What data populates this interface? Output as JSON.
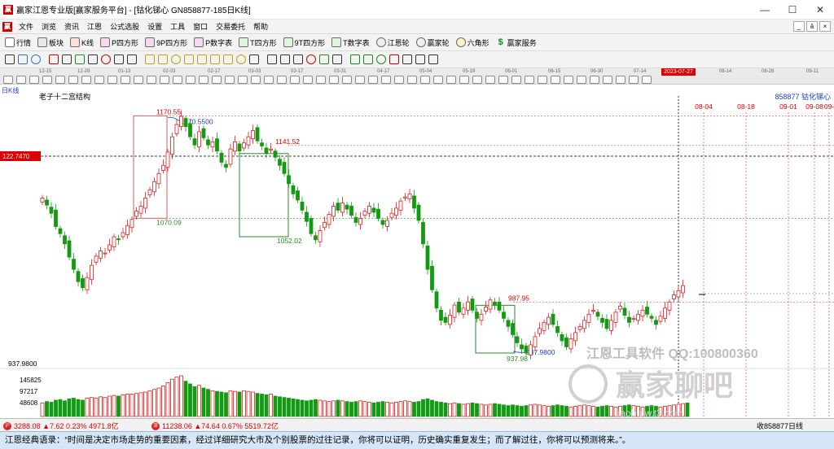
{
  "window": {
    "title": "赢家江恩专业版[赢家服务平台] - [钴化锑心 GN858877-185日K线]",
    "controls": [
      "—",
      "☐",
      "✕"
    ]
  },
  "menu": {
    "items": [
      "文件",
      "浏览",
      "资讯",
      "江恩",
      "公式选股",
      "设置",
      "工具",
      "窗口",
      "交易委托",
      "帮助"
    ],
    "mdi_controls": [
      "_",
      "ā",
      "×"
    ]
  },
  "toolbar": {
    "buttons": [
      "行情",
      "板块",
      "K线",
      "P四方形",
      "9P四方形",
      "P数字表",
      "T四方形",
      "9T四方形",
      "T数字表",
      "江恩轮",
      "赢家轮",
      "六角形",
      "赢家服务"
    ]
  },
  "date_strip": {
    "labels": [
      "12-15",
      "12-29",
      "01-13",
      "02-03",
      "02-17",
      "03-03",
      "03-17",
      "03-31",
      "04-17",
      "05-04",
      "05-19",
      "06-01",
      "06-15",
      "06-30",
      "07-14",
      "07-27",
      "08-14",
      "08-28",
      "09-11"
    ],
    "current": "2023-07-27"
  },
  "header": {
    "period": "日K线",
    "structure_name": "老子十二宫结构",
    "code_name": "858877  钴化锑心",
    "future_dates": [
      "08-04",
      "08-18",
      "09-01",
      "09-08",
      "09-"
    ]
  },
  "annotations": {
    "left_price": "122.7470",
    "low_label_left": "937.9800",
    "price_levels": [
      "1170.55",
      "1141.52",
      "1070.09",
      "1052.02",
      "987.95",
      "937.98",
      "937.9800"
    ],
    "swing_label": "1170.5500",
    "vol_ticks": [
      "145825",
      "97217",
      "48608"
    ]
  },
  "watermark": {
    "line1": "江恩工具软件 QQ:100800360",
    "line2": "赢家聊吧",
    "line3": "liaoba.w.t3.com"
  },
  "status": {
    "index1": {
      "value": "3288.08",
      "change": "▲7.62",
      "pct": "0.23%",
      "amount": "4971.8亿"
    },
    "index2": {
      "value": "11238.06",
      "change": "▲74.64",
      "pct": "0.67%",
      "amount": "5519.72亿"
    },
    "right": "收858877日线"
  },
  "quote": "江恩经典语录：“时间是决定市场走势的重要因素，经过详细研究大市及个别股票的过往记录，你将可以证明，历史确实重复发生；而了解过往，你将可以预测将来。”。",
  "chart_data": {
    "type": "candlestick",
    "y_range": [
      930,
      1190
    ],
    "levels": {
      "hi": 1170.55,
      "box1_hi": 1141.52,
      "box1_lo": 1070.09,
      "box2_lo": 1052.02,
      "box3_hi": 987.95,
      "box3_lo": 937.98
    },
    "closes": [
      1090,
      1083,
      1075,
      1062,
      1055,
      1045,
      1032,
      1020,
      1008,
      1002,
      1012,
      1024,
      1033,
      1038,
      1036,
      1044,
      1052,
      1049,
      1056,
      1063,
      1069,
      1077,
      1082,
      1090,
      1098,
      1106,
      1114,
      1122,
      1135,
      1150,
      1162,
      1170,
      1160,
      1150,
      1142,
      1155,
      1149,
      1142,
      1145,
      1136,
      1125,
      1120,
      1138,
      1145,
      1136,
      1144,
      1150,
      1156,
      1146,
      1141,
      1134,
      1138,
      1130,
      1122,
      1114,
      1104,
      1094,
      1088,
      1078,
      1067,
      1055,
      1049,
      1058,
      1066,
      1074,
      1082,
      1078,
      1085,
      1079,
      1073,
      1066,
      1070,
      1077,
      1082,
      1076,
      1070,
      1064,
      1068,
      1075,
      1080,
      1087,
      1091,
      1094,
      1080,
      1068,
      1045,
      1020,
      1000,
      982,
      970,
      968,
      975,
      985,
      978,
      982,
      988,
      980,
      972,
      976,
      983,
      990,
      985,
      980,
      972,
      964,
      956,
      948,
      942,
      938,
      946,
      954,
      962,
      968,
      973,
      966,
      958,
      950,
      944,
      952,
      958,
      964,
      970,
      976,
      980,
      974,
      968,
      962,
      970,
      978,
      984,
      975,
      968,
      972,
      976,
      980,
      976,
      972,
      966,
      974,
      982,
      988,
      995,
      999,
      1004
    ],
    "volumes": [
      20,
      22,
      21,
      24,
      25,
      23,
      26,
      27,
      25,
      24,
      27,
      28,
      27,
      29,
      28,
      30,
      31,
      30,
      32,
      33,
      33,
      34,
      35,
      36,
      38,
      40,
      42,
      45,
      50,
      55,
      58,
      60,
      52,
      48,
      44,
      46,
      42,
      40,
      38,
      37,
      36,
      35,
      38,
      37,
      36,
      38,
      37,
      36,
      34,
      33,
      32,
      33,
      30,
      29,
      28,
      27,
      26,
      25,
      24,
      23,
      24,
      25,
      24,
      23,
      22,
      23,
      24,
      23,
      22,
      21,
      22,
      23,
      22,
      21,
      20,
      21,
      22,
      21,
      20,
      21,
      22,
      23,
      22,
      21,
      22,
      25,
      26,
      24,
      22,
      21,
      20,
      19,
      20,
      19,
      18,
      19,
      20,
      19,
      18,
      17,
      18,
      19,
      18,
      17,
      16,
      17,
      16,
      15,
      16,
      17,
      18,
      17,
      16,
      15,
      16,
      17,
      16,
      15,
      14,
      15,
      16,
      17,
      16,
      15,
      14,
      15,
      16,
      15,
      14,
      15,
      16,
      17,
      16,
      15,
      14,
      15,
      16,
      15,
      14,
      15,
      16,
      17,
      18,
      19,
      20
    ]
  }
}
